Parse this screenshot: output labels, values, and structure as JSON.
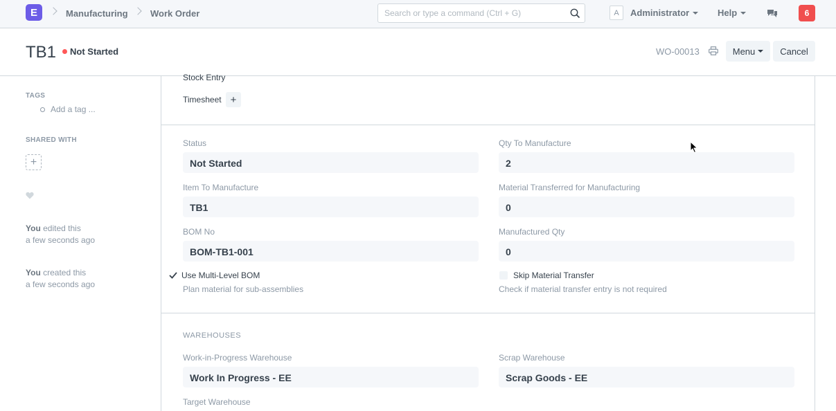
{
  "app": {
    "logo_letter": "E"
  },
  "breadcrumbs": [
    "Manufacturing",
    "Work Order"
  ],
  "search": {
    "placeholder": "Search or type a command (Ctrl + G)"
  },
  "navbar": {
    "avatar_letter": "A",
    "user_label": "Administrator",
    "help_label": "Help",
    "notification_count": "6"
  },
  "page": {
    "title": "TB1",
    "status": "Not Started",
    "doc_name": "WO-00013",
    "menu_label": "Menu",
    "cancel_label": "Cancel"
  },
  "sidebar": {
    "tags_label": "TAGS",
    "add_tag": "Add a tag ...",
    "shared_label": "SHARED WITH",
    "timeline": [
      {
        "who": "You",
        "action": " edited this",
        "when": "a few seconds ago"
      },
      {
        "who": "You",
        "action": " created this",
        "when": "a few seconds ago"
      }
    ]
  },
  "connections": {
    "stock_entry": "Stock Entry",
    "timesheet": "Timesheet"
  },
  "form": {
    "status": {
      "label": "Status",
      "value": "Not Started"
    },
    "qty_to_manufacture": {
      "label": "Qty To Manufacture",
      "value": "2"
    },
    "item_to_manufacture": {
      "label": "Item To Manufacture",
      "value": "TB1"
    },
    "material_transferred": {
      "label": "Material Transferred for Manufacturing",
      "value": "0"
    },
    "bom_no": {
      "label": "BOM No",
      "value": "BOM-TB1-001"
    },
    "manufactured_qty": {
      "label": "Manufactured Qty",
      "value": "0"
    },
    "use_multi_level_bom": {
      "label": "Use Multi-Level BOM",
      "checked": true,
      "help": "Plan material for sub-assemblies"
    },
    "skip_material_transfer": {
      "label": "Skip Material Transfer",
      "checked": false,
      "help": "Check if material transfer entry is not required"
    }
  },
  "warehouses": {
    "section_title": "WAREHOUSES",
    "wip": {
      "label": "Work-in-Progress Warehouse",
      "value": "Work In Progress - EE"
    },
    "scrap": {
      "label": "Scrap Warehouse",
      "value": "Scrap Goods - EE"
    },
    "target": {
      "label": "Target Warehouse"
    }
  },
  "colors": {
    "brand": "#6c5ce7",
    "status_red": "#ff5858",
    "notification": "#f04e4e"
  }
}
